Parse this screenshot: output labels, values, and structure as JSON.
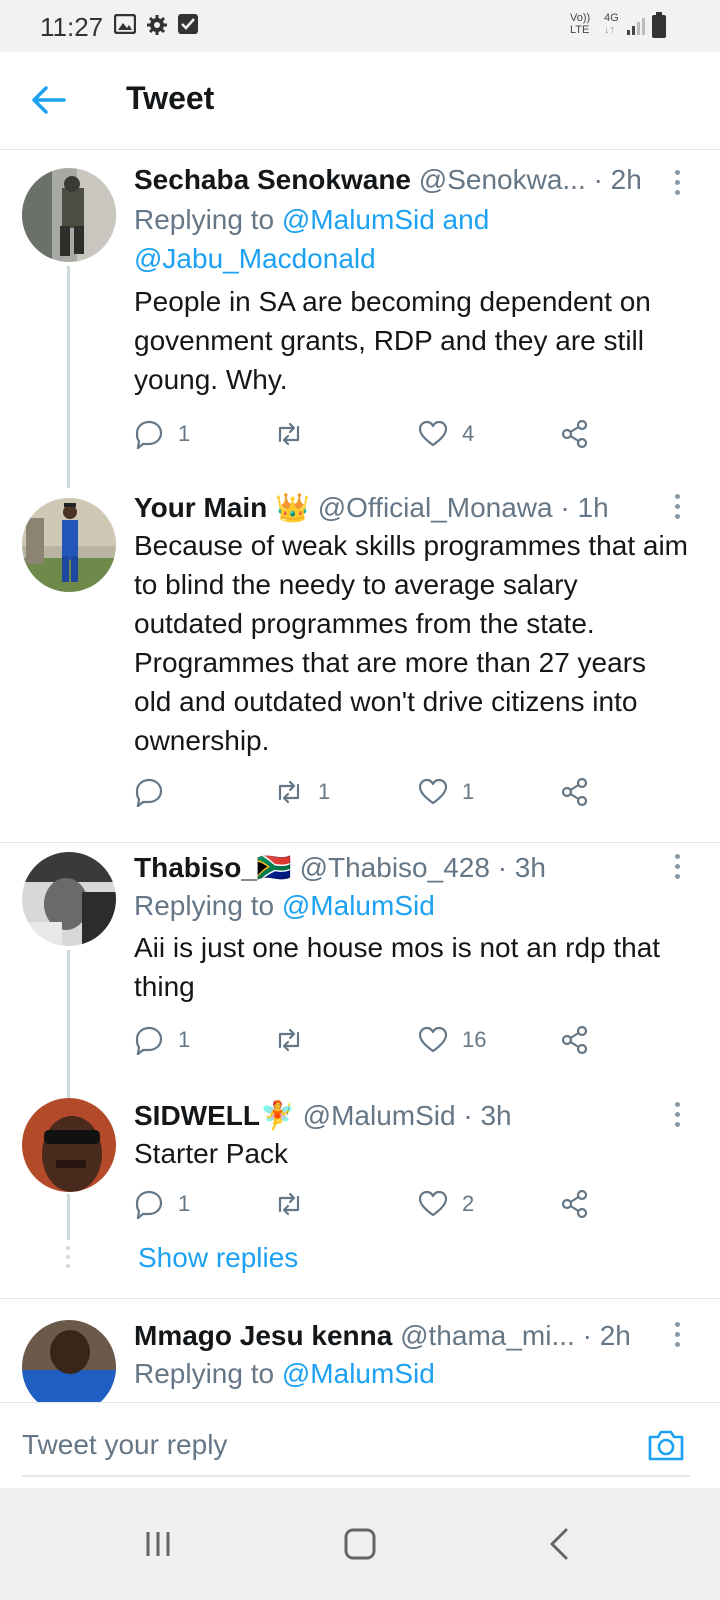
{
  "status_bar": {
    "time": "11:27",
    "net_top": "Vo))",
    "net_bottom": "LTE",
    "gen_top": "4G",
    "gen_bottom": "↓↑"
  },
  "header": {
    "title": "Tweet"
  },
  "tweets": [
    {
      "name": "Sechaba Senokwane",
      "handle": "@Senokwa...",
      "time": "2h",
      "replying_prefix": "Replying to",
      "replying_links_1": "@MalumSid and",
      "replying_links_2": "@Jabu_Macdonald",
      "text": "People in SA are becoming dependent on govenment grants, RDP and they are still young. Why.",
      "replies": "1",
      "retweets": "",
      "likes": "4"
    },
    {
      "name": "Your Main",
      "emoji": "👑",
      "handle": "@Official_Monawa",
      "time": "1h",
      "text": "Because of weak skills programmes that aim to blind the needy to average salary outdated programmes from the state. Programmes that are more than 27 years old and outdated won't drive citizens into ownership.",
      "replies": "",
      "retweets": "1",
      "likes": "1"
    },
    {
      "name": "Thabiso_",
      "emoji": "🇿🇦",
      "handle": "@Thabiso_428",
      "time": "3h",
      "replying_prefix": "Replying to",
      "replying_links_1": "@MalumSid",
      "text": "Aii is just one house mos is not an rdp that thing",
      "replies": "1",
      "retweets": "",
      "likes": "16"
    },
    {
      "name": "SIDWELL",
      "emoji": "🧚",
      "handle": "@MalumSid",
      "time": "3h",
      "text": "Starter Pack",
      "replies": "1",
      "retweets": "",
      "likes": "2"
    },
    {
      "name": "Mmago Jesu kenna",
      "handle": "@thama_mi...",
      "time": "2h",
      "replying_prefix": "Replying to",
      "replying_links_1": "@MalumSid"
    }
  ],
  "show_replies": "Show replies",
  "reply_bar": {
    "placeholder": "Tweet your reply"
  },
  "colors": {
    "accent": "#1da1f2",
    "text": "#14171a",
    "secondary": "#657786"
  }
}
